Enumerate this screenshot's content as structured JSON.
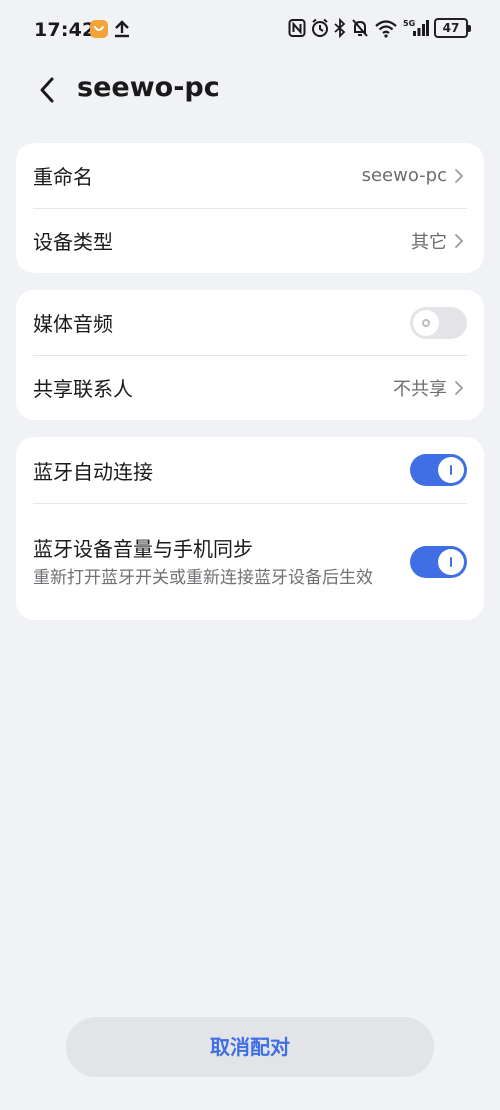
{
  "status_bar": {
    "time": "17:42",
    "battery": "47",
    "network": "5G"
  },
  "header": {
    "title": "seewo-pc"
  },
  "groups": [
    {
      "rows": [
        {
          "label": "重命名",
          "value": "seewo-pc"
        },
        {
          "label": "设备类型",
          "value": "其它"
        }
      ]
    },
    {
      "rows": [
        {
          "label": "媒体音频",
          "toggle": false
        },
        {
          "label": "共享联系人",
          "value": "不共享"
        }
      ]
    },
    {
      "rows": [
        {
          "label": "蓝牙自动连接",
          "toggle": true
        },
        {
          "label": "蓝牙设备音量与手机同步",
          "sublabel": "重新打开蓝牙开关或重新连接蓝牙设备后生效",
          "toggle": true
        }
      ]
    }
  ],
  "footer": {
    "unpair_label": "取消配对"
  },
  "colors": {
    "accent": "#3f6ee5",
    "background": "#f1f2f6"
  }
}
